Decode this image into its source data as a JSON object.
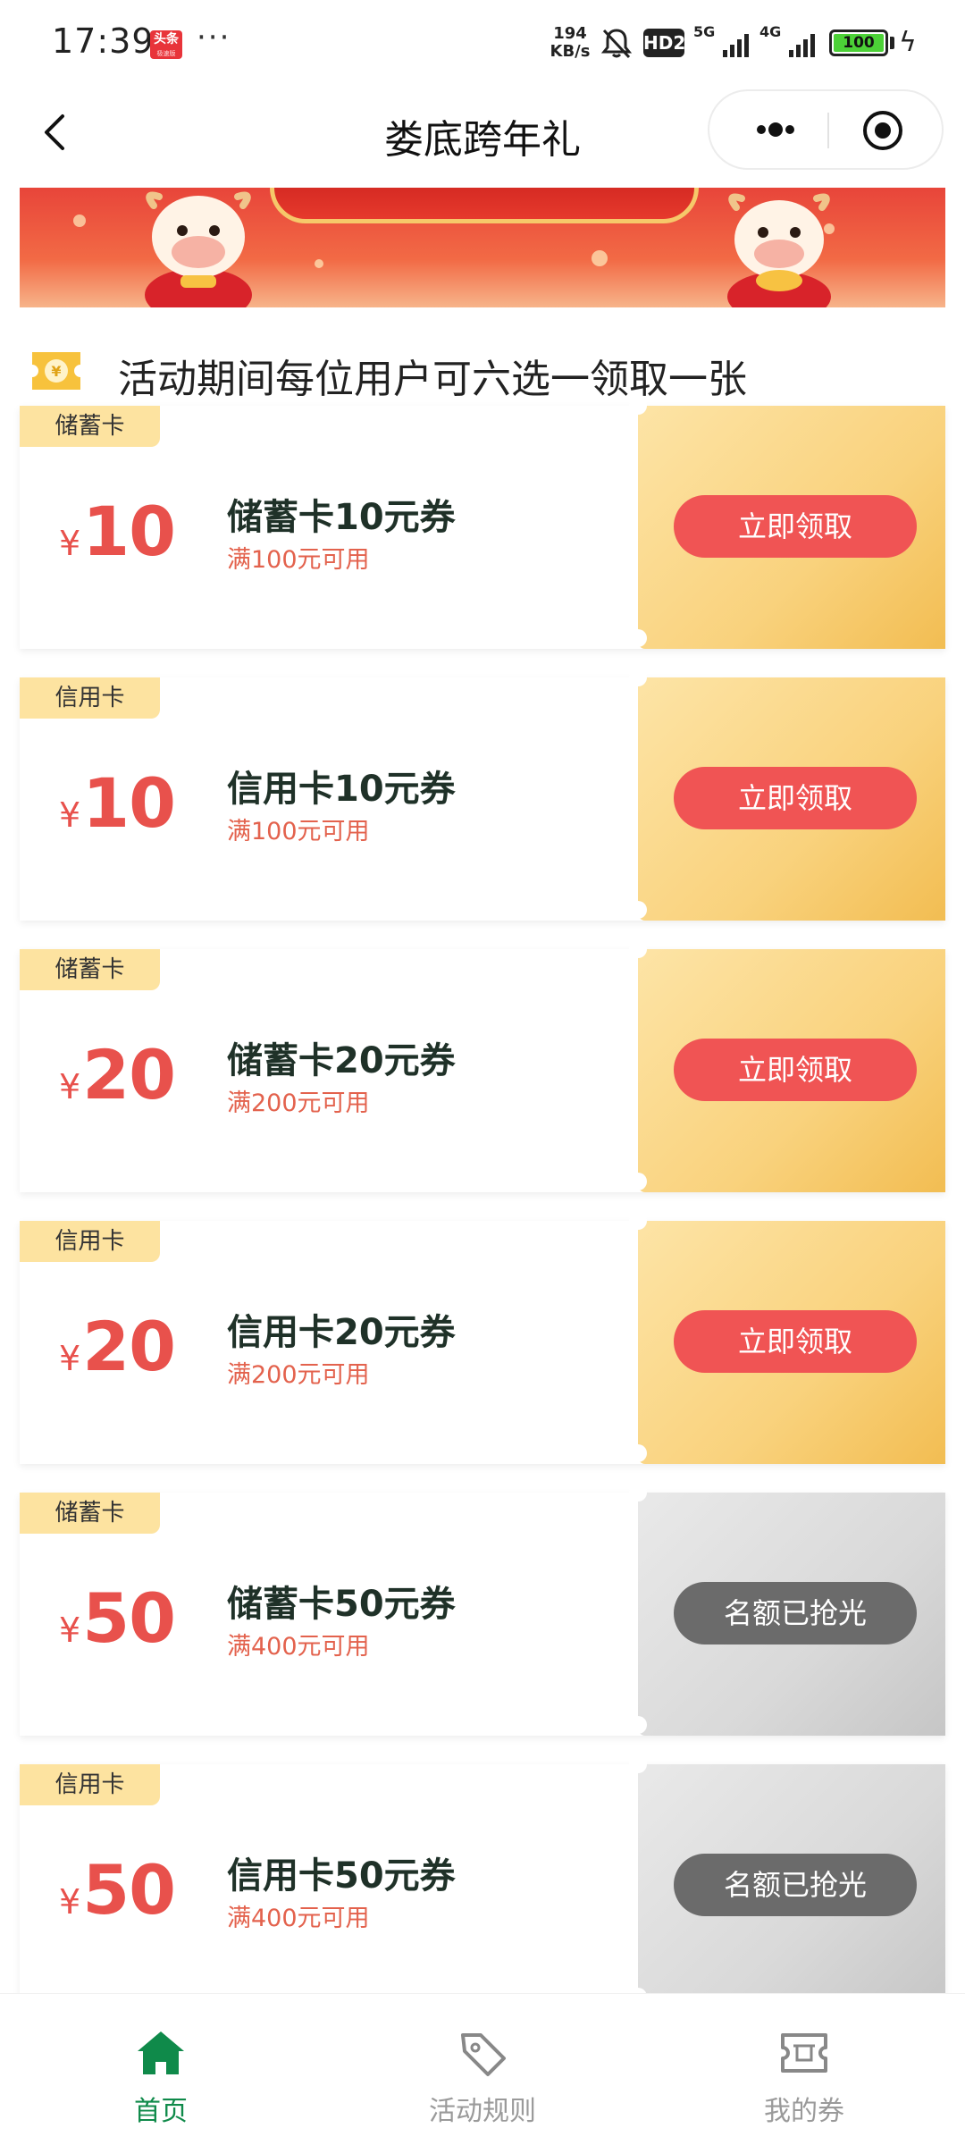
{
  "status_bar": {
    "time": "17:39",
    "news_badge": "头条",
    "news_badge_sub": "极速版",
    "dots": "···",
    "net_speed_value": "194",
    "net_speed_unit": "KB/s",
    "hd": "HD2",
    "signal_5g": "5G",
    "signal_4g": "4G",
    "battery": "100"
  },
  "nav": {
    "title": "娄底跨年礼"
  },
  "hint": {
    "text": "活动期间每位用户可六选一领取一张"
  },
  "coupons": [
    {
      "tag": "储蓄卡",
      "yen": "¥",
      "amount": "10",
      "title": "储蓄卡10元券",
      "condition": "满100元可用",
      "button": "立即领取",
      "available": true
    },
    {
      "tag": "信用卡",
      "yen": "¥",
      "amount": "10",
      "title": "信用卡10元券",
      "condition": "满100元可用",
      "button": "立即领取",
      "available": true
    },
    {
      "tag": "储蓄卡",
      "yen": "¥",
      "amount": "20",
      "title": "储蓄卡20元券",
      "condition": "满200元可用",
      "button": "立即领取",
      "available": true
    },
    {
      "tag": "信用卡",
      "yen": "¥",
      "amount": "20",
      "title": "信用卡20元券",
      "condition": "满200元可用",
      "button": "立即领取",
      "available": true
    },
    {
      "tag": "储蓄卡",
      "yen": "¥",
      "amount": "50",
      "title": "储蓄卡50元券",
      "condition": "满400元可用",
      "button": "名额已抢光",
      "available": false
    },
    {
      "tag": "信用卡",
      "yen": "¥",
      "amount": "50",
      "title": "信用卡50元券",
      "condition": "满400元可用",
      "button": "名额已抢光",
      "available": false
    }
  ],
  "tabs": [
    {
      "label": "首页",
      "icon": "home-icon",
      "active": true
    },
    {
      "label": "活动规则",
      "icon": "tag-icon",
      "active": false
    },
    {
      "label": "我的券",
      "icon": "ticket-icon",
      "active": false
    }
  ],
  "colors": {
    "accent_green": "#0f8a4a",
    "claim_red": "#f05454",
    "sold_out_gray": "#6b6b6b",
    "amount_red": "#e8514c",
    "stub_gold": "#f9d27d"
  }
}
